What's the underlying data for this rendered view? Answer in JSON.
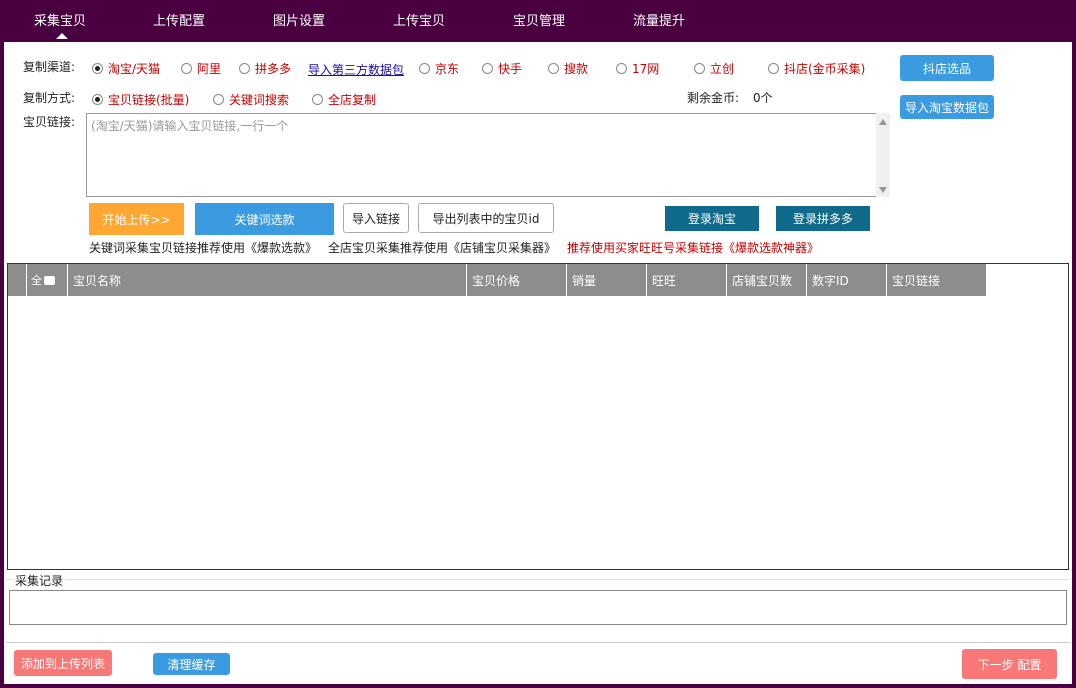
{
  "nav": {
    "tabs": [
      {
        "label": "采集宝贝"
      },
      {
        "label": "上传配置"
      },
      {
        "label": "图片设置"
      },
      {
        "label": "上传宝贝"
      },
      {
        "label": "宝贝管理"
      },
      {
        "label": "流量提升"
      }
    ]
  },
  "channel": {
    "label": "复制渠道:",
    "options": [
      "淘宝/天猫",
      "阿里",
      "拼多多",
      "京东",
      "快手",
      "搜款",
      "17网",
      "立创",
      "抖店(金币采集)"
    ],
    "selected": "淘宝/天猫",
    "third_party_link": "导入第三方数据包",
    "douyin_button": "抖店选品"
  },
  "method": {
    "label": "复制方式:",
    "options": [
      "宝贝链接(批量)",
      "关键词搜索",
      "全店复制"
    ],
    "selected": "宝贝链接(批量)",
    "coins_label": "剩余金币:",
    "coins_value": "0个",
    "import_taobao_button": "导入淘宝数据包"
  },
  "links": {
    "label": "宝贝链接:",
    "placeholder": "(淘宝/天猫)请输入宝贝链接,一行一个"
  },
  "actions": {
    "start_upload": "开始上传>>",
    "keyword_select": "关键词选款",
    "import_links": "导入链接",
    "export_ids": "导出列表中的宝贝id",
    "login_taobao": "登录淘宝",
    "login_pdd": "登录拼多多"
  },
  "hints": {
    "keyword_hint": "关键词采集宝贝链接推荐使用《爆款选款》",
    "shop_hint": "全店宝贝采集推荐使用《店铺宝贝采集器》",
    "wangwang_hint": "推荐使用买家旺旺号采集链接《爆款选款神器》"
  },
  "table": {
    "select_all_label": "全",
    "columns": [
      "宝贝名称",
      "宝贝价格",
      "销量",
      "旺旺",
      "店铺宝贝数",
      "数字ID",
      "宝贝链接"
    ],
    "rows": []
  },
  "log": {
    "title": "采集记录"
  },
  "footer": {
    "add_to_upload": "添加到上传列表",
    "clear_cache": "清理缓存",
    "next_step": "下一步 配置"
  },
  "colors": {
    "nav_bg": "#4a0040",
    "accent_blue": "#3a9be0",
    "orange": "#ffa733",
    "navy": "#0f6a8c",
    "red_button": "#f87878",
    "option_red": "#cc0000",
    "header_gray": "#8d8d8d"
  }
}
